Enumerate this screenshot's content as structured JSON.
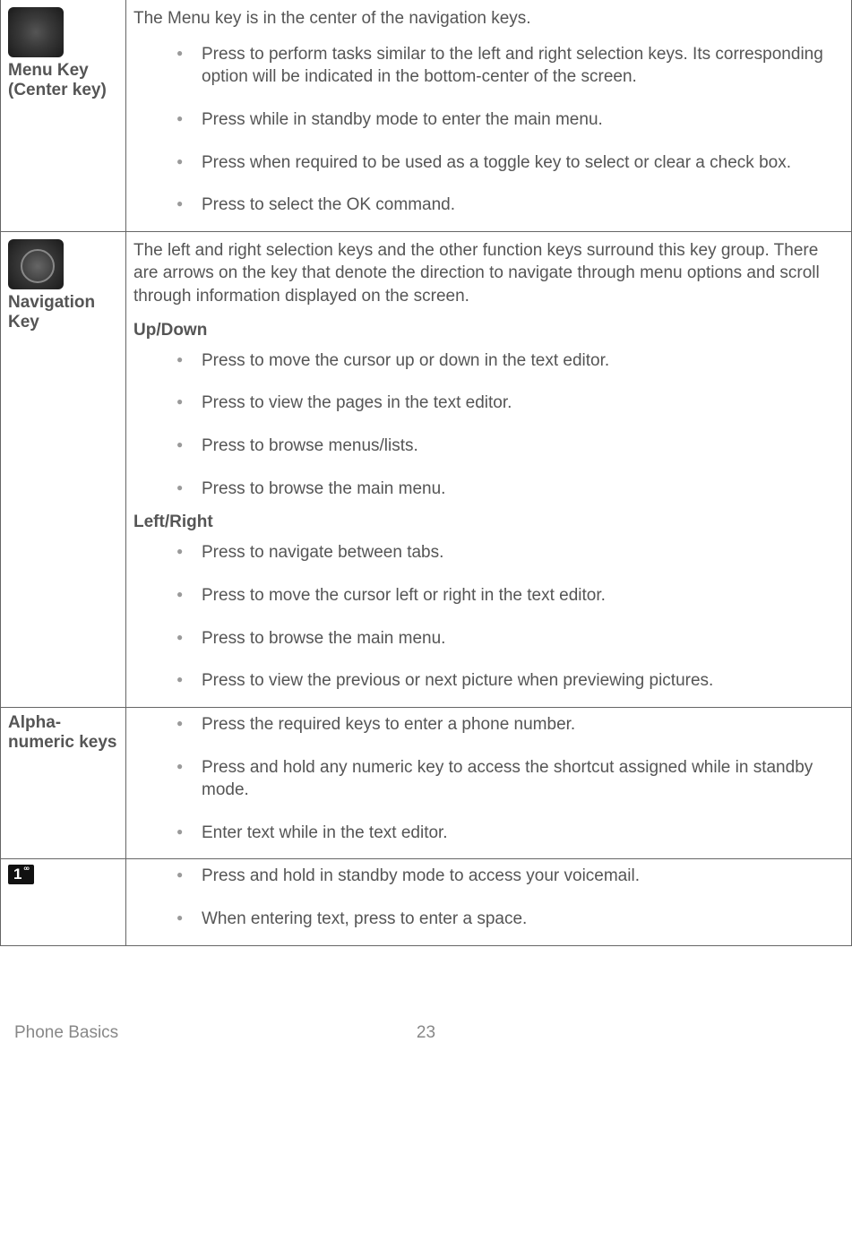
{
  "rows": [
    {
      "label_extra": "Menu Key (Center key)",
      "has_icon": true,
      "icon_class": "menu",
      "intro": "The Menu key is in the center of the navigation keys.",
      "sections": [
        {
          "heading": null,
          "items": [
            "Press to perform tasks similar to the left and right selection keys. Its corresponding option will be indicated in the bottom-center of the screen.",
            "Press while in standby mode to enter the main menu.",
            "Press when required to be used as a toggle key to select or clear a check box.",
            "Press to select the OK command."
          ]
        }
      ]
    },
    {
      "label_extra": "Navigation Key",
      "has_icon": true,
      "icon_class": "nav",
      "intro": "The left and right selection keys and the other function keys surround this key group. There are arrows on the key that denote the direction to navigate through menu options and scroll through information displayed on the screen.",
      "sections": [
        {
          "heading": "Up/Down",
          "items": [
            "Press to move the cursor up or down in the text editor.",
            "Press to view the pages in the text editor.",
            "Press to browse menus/lists.",
            "Press to browse the main menu."
          ]
        },
        {
          "heading": "Left/Right",
          "items": [
            "Press to navigate between tabs.",
            "Press to move the cursor left or right in the text editor.",
            "Press to browse the main menu.",
            "Press to view the previous or next picture when previewing pictures."
          ]
        }
      ]
    },
    {
      "label_extra": "Alpha-numeric keys",
      "has_icon": false,
      "intro": null,
      "sections": [
        {
          "heading": null,
          "items": [
            "Press the required keys to enter a phone number.",
            "Press and hold any numeric key to access the shortcut assigned while in standby mode.",
            "Enter text while in the text editor."
          ]
        }
      ]
    },
    {
      "label_is_key1": true,
      "key1_digit": "1",
      "has_icon": false,
      "intro": null,
      "sections": [
        {
          "heading": null,
          "items": [
            "Press and hold in standby mode to access your voicemail.",
            "When entering text, press to enter a space."
          ]
        }
      ]
    }
  ],
  "footer": {
    "section": "Phone Basics",
    "page": "23"
  }
}
